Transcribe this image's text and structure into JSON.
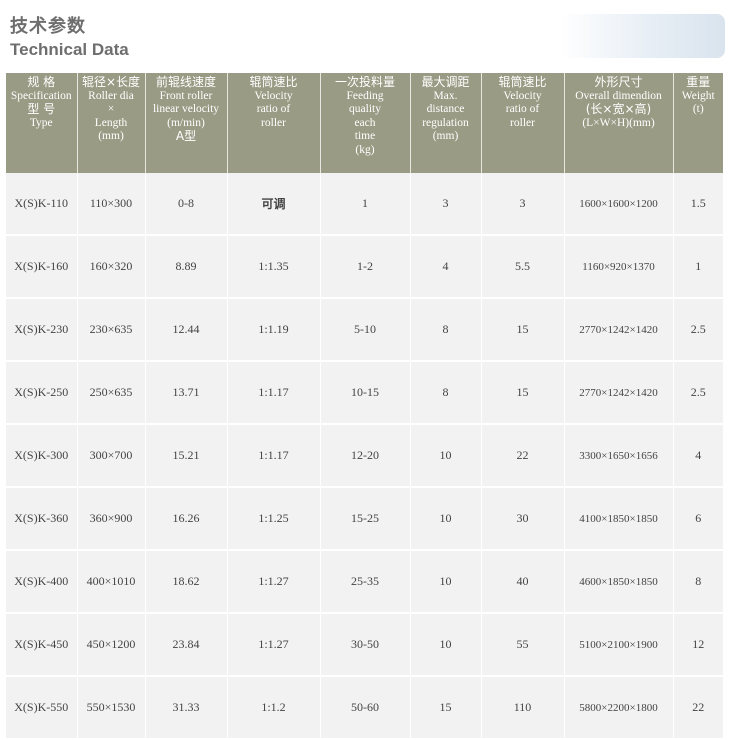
{
  "title_cn": "技术参数",
  "title_en": "Technical Data",
  "headers": [
    {
      "lines": [
        "规 格",
        "Specification",
        "型 号",
        "Type"
      ]
    },
    {
      "lines": [
        "辊径×长度",
        "Roller dia",
        "×",
        "Length",
        "(mm)"
      ]
    },
    {
      "lines": [
        "前辊线速度",
        "Front roller",
        "linear velocity",
        "(m/min)",
        "A型"
      ]
    },
    {
      "lines": [
        "辊筒速比",
        "Velocity",
        "ratio of",
        "roller"
      ]
    },
    {
      "lines": [
        "一次投料量",
        "Feeding",
        "quality",
        "each",
        "time",
        "(kg)"
      ]
    },
    {
      "lines": [
        "最大调距",
        "Max.",
        "distance",
        "regulation",
        "(mm)"
      ]
    },
    {
      "lines": [
        "辊筒速比",
        "Velocity",
        "ratio of",
        "roller"
      ]
    },
    {
      "lines": [
        "外形尺寸",
        "Overall dimendion",
        "(长×宽×高)",
        "(L×W×H)(mm)"
      ]
    },
    {
      "lines": [
        "重量",
        "Weight",
        "(t)"
      ]
    }
  ],
  "rows": [
    [
      "X(S)K-110",
      "110×300",
      "0-8",
      "可调",
      "1",
      "3",
      "3",
      "1600×1600×1200",
      "1.5"
    ],
    [
      "X(S)K-160",
      "160×320",
      "8.89",
      "1:1.35",
      "1-2",
      "4",
      "5.5",
      "1160×920×1370",
      "1"
    ],
    [
      "X(S)K-230",
      "230×635",
      "12.44",
      "1:1.19",
      "5-10",
      "8",
      "15",
      "2770×1242×1420",
      "2.5"
    ],
    [
      "X(S)K-250",
      "250×635",
      "13.71",
      "1:1.17",
      "10-15",
      "8",
      "15",
      "2770×1242×1420",
      "2.5"
    ],
    [
      "X(S)K-300",
      "300×700",
      "15.21",
      "1:1.17",
      "12-20",
      "10",
      "22",
      "3300×1650×1656",
      "4"
    ],
    [
      "X(S)K-360",
      "360×900",
      "16.26",
      "1:1.25",
      "15-25",
      "10",
      "30",
      "4100×1850×1850",
      "6"
    ],
    [
      "X(S)K-400",
      "400×1010",
      "18.62",
      "1:1.27",
      "25-35",
      "10",
      "40",
      "4600×1850×1850",
      "8"
    ],
    [
      "X(S)K-450",
      "450×1200",
      "23.84",
      "1:1.27",
      "30-50",
      "10",
      "55",
      "5100×2100×1900",
      "12"
    ],
    [
      "X(S)K-550",
      "550×1530",
      "31.33",
      "1:1.2",
      "50-60",
      "15",
      "110",
      "5800×2200×1800",
      "22"
    ]
  ]
}
